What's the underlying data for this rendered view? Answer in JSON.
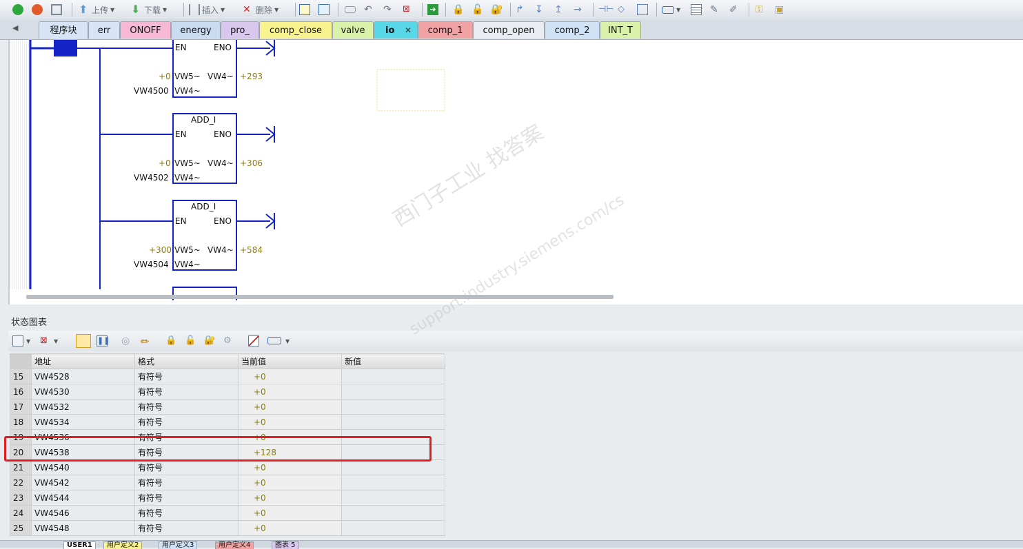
{
  "toolbar": {
    "upload_label": "上传",
    "download_label": "下载",
    "insert_label": "插入",
    "delete_label": "删除"
  },
  "tabs": [
    {
      "label": "程序块",
      "color": "#d6e4f5"
    },
    {
      "label": "err",
      "color": "#d6e4f5"
    },
    {
      "label": "ONOFF",
      "color": "#f7b8d6"
    },
    {
      "label": "energy",
      "color": "#c9dcf2"
    },
    {
      "label": "pro_",
      "color": "#d9c7ee"
    },
    {
      "label": "comp_close",
      "color": "#f8f28f"
    },
    {
      "label": "valve",
      "color": "#d9f1a8"
    },
    {
      "label": "io",
      "color": "#58d7e8",
      "active": true
    },
    {
      "label": "comp_1",
      "color": "#f1a3a3"
    },
    {
      "label": "comp_open",
      "color": "#e9edf2"
    },
    {
      "label": "comp_2",
      "color": "#cfe2f6"
    },
    {
      "label": "INT_T",
      "color": "#d9f1a8"
    }
  ],
  "ladder": {
    "blocks": [
      {
        "title": "",
        "en": "EN",
        "eno": "ENO",
        "in1_value": "+0",
        "in1_pin": "VW5~",
        "out_pin": "VW4~",
        "out_value": "+293",
        "in2_value": "VW4500",
        "in2_pin": "VW4~"
      },
      {
        "title": "ADD_I",
        "en": "EN",
        "eno": "ENO",
        "in1_value": "+0",
        "in1_pin": "VW5~",
        "out_pin": "VW4~",
        "out_value": "+306",
        "in2_value": "VW4502",
        "in2_pin": "VW4~"
      },
      {
        "title": "ADD_I",
        "en": "EN",
        "eno": "ENO",
        "in1_value": "+300",
        "in1_pin": "VW5~",
        "out_pin": "VW4~",
        "out_value": "+584",
        "in2_value": "VW4504",
        "in2_pin": "VW4~"
      }
    ]
  },
  "status_chart": {
    "title": "状态图表",
    "columns": [
      "地址",
      "格式",
      "当前值",
      "新值"
    ],
    "rows": [
      {
        "n": "15",
        "addr": "VW4528",
        "fmt": "有符号",
        "cur": "+0",
        "new": ""
      },
      {
        "n": "16",
        "addr": "VW4530",
        "fmt": "有符号",
        "cur": "+0",
        "new": ""
      },
      {
        "n": "17",
        "addr": "VW4532",
        "fmt": "有符号",
        "cur": "+0",
        "new": ""
      },
      {
        "n": "18",
        "addr": "VW4534",
        "fmt": "有符号",
        "cur": "+0",
        "new": ""
      },
      {
        "n": "19",
        "addr": "VW4536",
        "fmt": "有符号",
        "cur": "+0",
        "new": ""
      },
      {
        "n": "20",
        "addr": "VW4538",
        "fmt": "有符号",
        "cur": "+128",
        "new": ""
      },
      {
        "n": "21",
        "addr": "VW4540",
        "fmt": "有符号",
        "cur": "+0",
        "new": ""
      },
      {
        "n": "22",
        "addr": "VW4542",
        "fmt": "有符号",
        "cur": "+0",
        "new": ""
      },
      {
        "n": "23",
        "addr": "VW4544",
        "fmt": "有符号",
        "cur": "+0",
        "new": ""
      },
      {
        "n": "24",
        "addr": "VW4546",
        "fmt": "有符号",
        "cur": "+0",
        "new": ""
      },
      {
        "n": "25",
        "addr": "VW4548",
        "fmt": "有符号",
        "cur": "+0",
        "new": ""
      }
    ]
  },
  "bottom_tabs": [
    "USER1",
    "用户定义2",
    "用户定义3",
    "用户定义4",
    "图表 5"
  ],
  "watermark": {
    "line1": "西门子工业   找答案",
    "line2": "support.industry.siemens.com/cs"
  },
  "colors": {
    "ladder_blue": "#1424c8",
    "live_value": "#8b7d10",
    "highlight": "#e02020"
  }
}
